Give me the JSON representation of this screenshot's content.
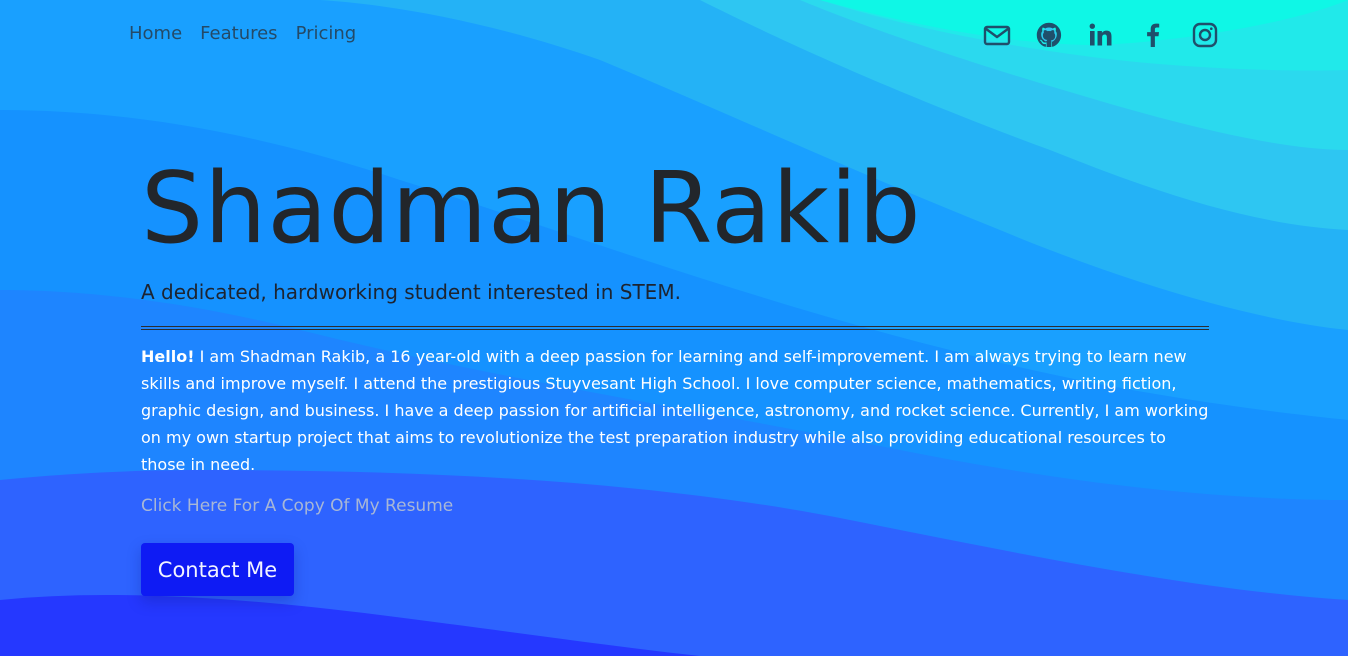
{
  "nav": {
    "links": [
      {
        "label": "Home"
      },
      {
        "label": "Features"
      },
      {
        "label": "Pricing"
      }
    ],
    "icons": [
      "mail-icon",
      "github-icon",
      "linkedin-icon",
      "facebook-icon",
      "instagram-icon"
    ]
  },
  "hero": {
    "title": "Shadman Rakib",
    "tagline": "A dedicated, hardworking student interested in STEM.",
    "bio_greeting": "Hello!",
    "bio_text": " I am Shadman Rakib, a 16 year-old with a deep passion for learning and self-improvement. I am always trying to learn new skills and improve myself. I attend the prestigious Stuyvesant High School. I love computer science, mathematics, writing fiction, graphic design, and business. I have a deep passion for artificial intelligence, astronomy, and rocket science. Currently, I am working on my own startup project that aims to revolutionize the test preparation industry while also providing educational resources to those in need.",
    "resume_link": "Click Here For A Copy Of My Resume",
    "contact_button": "Contact Me"
  },
  "colors": {
    "accent_button": "#0e1bf4",
    "wave_top": "#00ffe0",
    "wave_bottom": "#2233ff"
  }
}
